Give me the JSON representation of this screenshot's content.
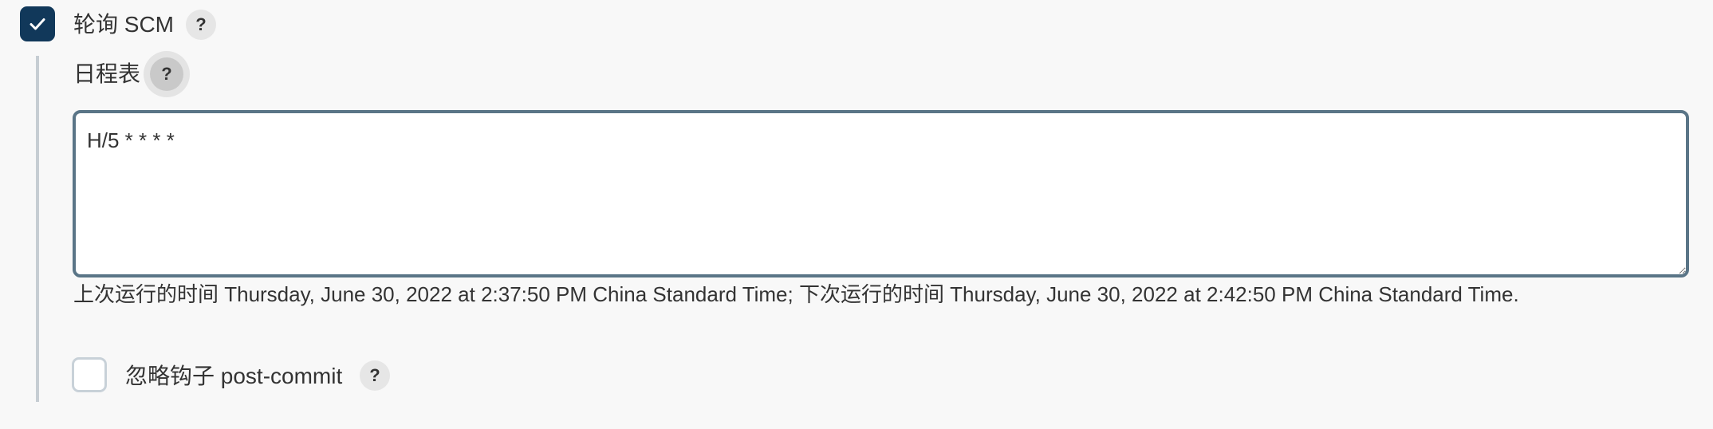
{
  "poll_scm": {
    "label": "轮询 SCM",
    "checked": true,
    "help_icon": "?"
  },
  "schedule": {
    "label": "日程表",
    "help_icon": "?",
    "value": "H/5 * * * *",
    "info": "上次运行的时间 Thursday, June 30, 2022 at 2:37:50 PM China Standard Time; 下次运行的时间 Thursday, June 30, 2022 at 2:42:50 PM China Standard Time."
  },
  "ignore_post_commit": {
    "label": "忽略钩子 post-commit",
    "checked": false,
    "help_icon": "?"
  },
  "colors": {
    "checked_fill": "#11385a",
    "background": "#f8f8f8",
    "textarea_border": "#5a7587"
  },
  "icons": {
    "check": "check-icon",
    "help": "help-icon",
    "resize": "resize-grip-icon"
  }
}
